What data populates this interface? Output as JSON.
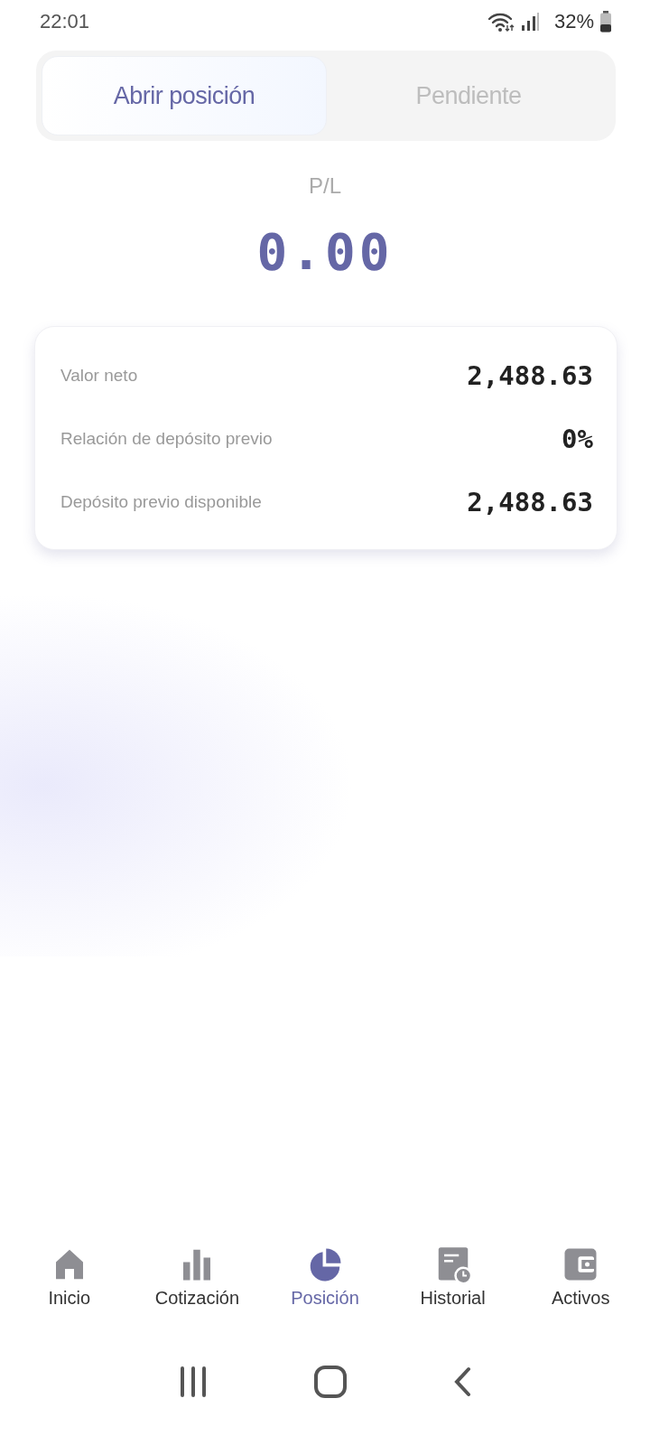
{
  "status_bar": {
    "time": "22:01",
    "battery": "32%"
  },
  "tabs": [
    {
      "label": "Abrir posición",
      "selected": true
    },
    {
      "label": "Pendiente",
      "selected": false
    }
  ],
  "pl": {
    "label": "P/L",
    "value": "0.00"
  },
  "summary": [
    {
      "label": "Valor neto",
      "value": "2,488.63"
    },
    {
      "label": "Relación de depósito previo",
      "value": "0%"
    },
    {
      "label": "Depósito previo disponible",
      "value": "2,488.63"
    }
  ],
  "bottom_nav": [
    {
      "label": "Inicio",
      "selected": false
    },
    {
      "label": "Cotización",
      "selected": false
    },
    {
      "label": "Posición",
      "selected": true
    },
    {
      "label": "Historial",
      "selected": false
    },
    {
      "label": "Activos",
      "selected": false
    }
  ]
}
